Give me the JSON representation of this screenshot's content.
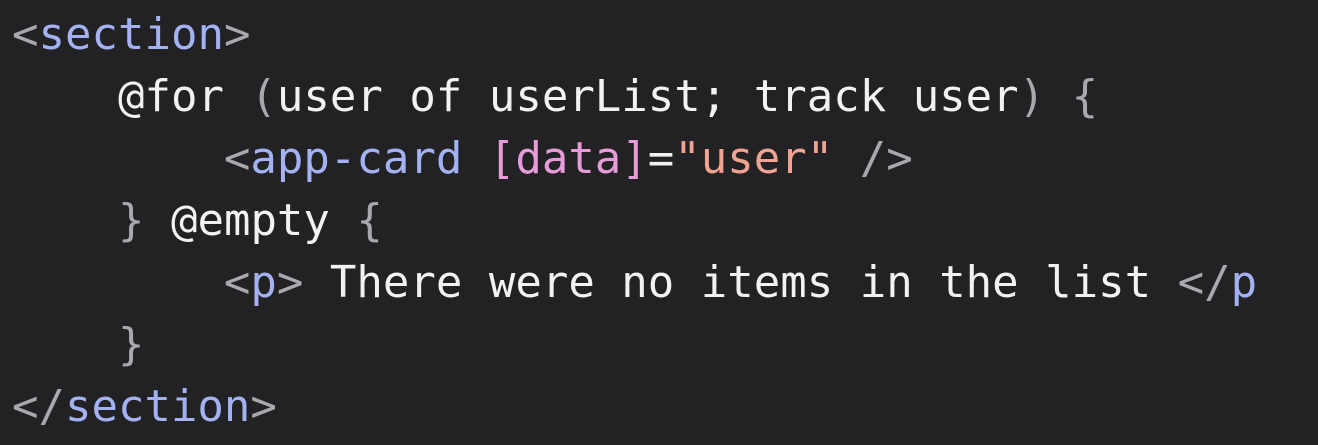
{
  "code": {
    "line1": {
      "open": "<",
      "tag": "section",
      "close": ">"
    },
    "line2": {
      "indent": "    ",
      "at_for": "@for",
      "paren_open": " (",
      "args": "user of userList; track user",
      "paren_close": ")",
      "brace": " {"
    },
    "line3": {
      "indent": "        ",
      "open": "<",
      "tag": "app-card",
      "space": " ",
      "attr": "[data]",
      "eq": "=",
      "value": "\"user\"",
      "selfclose": " />"
    },
    "line4": {
      "indent": "    ",
      "brace_close": "}",
      "space": " ",
      "at_empty": "@empty",
      "brace_open": " {"
    },
    "line5": {
      "indent": "        ",
      "open": "<",
      "tag": "p",
      "close": ">",
      "text": " There were no items in the list ",
      "close_open": "</",
      "close_tag": "p",
      "close_end": ""
    },
    "line6": {
      "indent": "    ",
      "brace_close": "}"
    },
    "line7": {
      "open": "</",
      "tag": "section",
      "close": ">"
    }
  },
  "colors": {
    "background": "#222224",
    "tag": "#a4b2f3",
    "punctuation": "#a9a9ad",
    "attribute": "#e89bd9",
    "string": "#f3a392",
    "text": "#f2f2f2"
  }
}
